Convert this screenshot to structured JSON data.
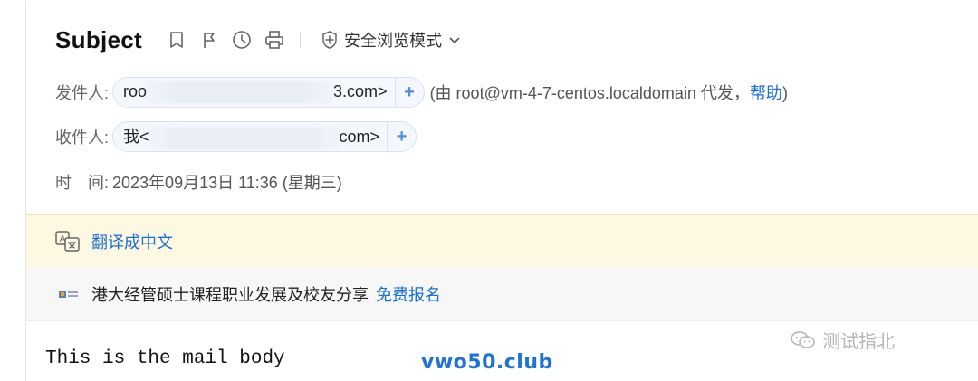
{
  "header": {
    "subject": "Subject",
    "toolbar": {
      "icons": [
        "bookmark-icon",
        "flag-icon",
        "clock-icon",
        "print-icon"
      ],
      "safe_mode_label": "安全浏览模式"
    },
    "from": {
      "label": "发件人:",
      "chip_start": "roo",
      "chip_end": "3.com>",
      "via_text": "(由 root@vm-4-7-centos.localdomain 代发，",
      "help_link": "帮助",
      "via_close": ")"
    },
    "to": {
      "label": "收件人:",
      "chip_start": "我<",
      "chip_end": "com>"
    },
    "time": {
      "label": "时　间:",
      "value": "2023年09月13日 11:36 (星期三)"
    }
  },
  "translate_bar": {
    "link": "翻译成中文"
  },
  "ad_bar": {
    "text": "港大经管硕士课程职业发展及校友分享",
    "link": "免费报名"
  },
  "mail_body": {
    "text": "This is the mail body"
  },
  "watermarks": {
    "left": "vwo50.club",
    "right": "测试指北"
  },
  "colors": {
    "link": "#1a6fd8",
    "translate_bg": "#fdf8e1",
    "ad_bg": "#f7f7f7",
    "chip_bg": "#f4f8fd",
    "chip_border": "#d7e3f2"
  }
}
